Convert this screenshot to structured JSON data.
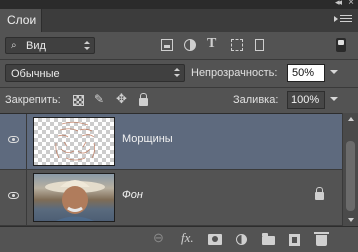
{
  "window": {
    "collapse_glyph": "◂◂",
    "close_glyph": "×"
  },
  "panel": {
    "tab_label": "Слои",
    "menu_icon": "panel-menu-icon"
  },
  "filter": {
    "kind_label": "Вид",
    "search_glyph": "⌕",
    "type_glyph": "T",
    "icons": [
      "pixel-filter-icon",
      "adjustment-filter-icon",
      "type-filter-icon",
      "shape-filter-icon",
      "smart-object-filter-icon",
      "filter-toggle-icon"
    ]
  },
  "blend": {
    "mode": "Обычные",
    "opacity_label": "Непрозрачность:",
    "opacity_value": "50%"
  },
  "lock": {
    "label": "Закрепить:",
    "brush_glyph": "✎",
    "move_glyph": "✥",
    "fill_label": "Заливка:",
    "fill_value": "100%"
  },
  "layers": [
    {
      "name": "Морщины",
      "visible": true,
      "selected": true,
      "locked": false,
      "thumbnail": "transparent"
    },
    {
      "name": "Фон",
      "visible": true,
      "selected": false,
      "locked": true,
      "thumbnail": "photo"
    }
  ],
  "toolbar": {
    "link_glyph": "⊖",
    "fx_label": "fx.",
    "icons": [
      "link-layers-icon",
      "fx-icon",
      "add-mask-icon",
      "adjustment-layer-icon",
      "group-folder-icon",
      "new-layer-icon",
      "trash-icon"
    ]
  },
  "colors": {
    "panel_bg": "#535353",
    "selected_row": "#5e6a7e",
    "dark_strip": "#2b2b2b"
  }
}
